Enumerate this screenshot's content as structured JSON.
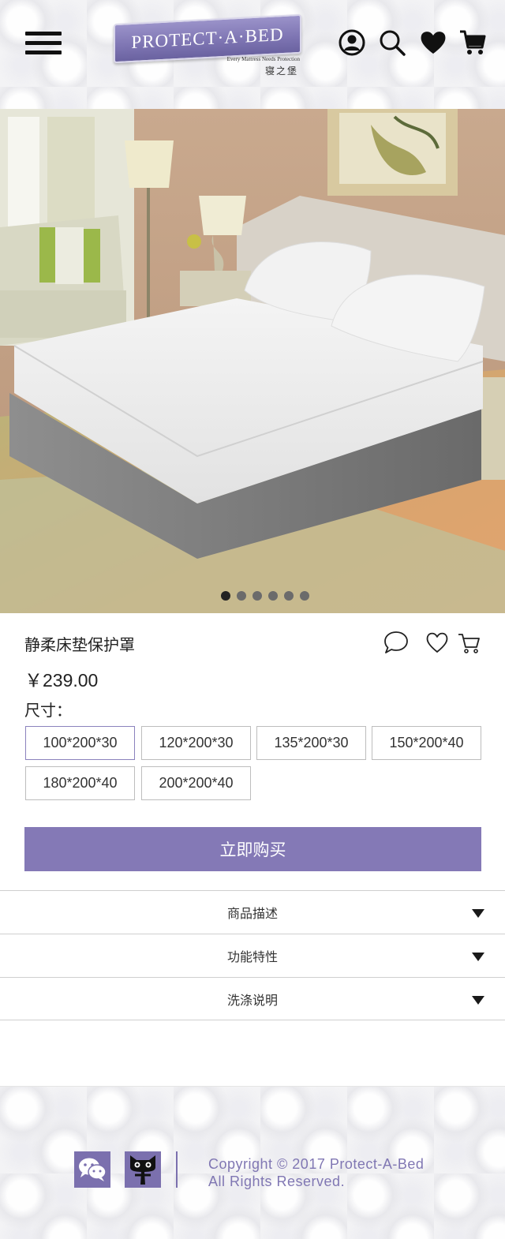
{
  "header": {
    "menu_icon": "hamburger-menu-icon",
    "logo": {
      "brand": "PROTECT·A·BED",
      "tagline": "Every Mattress Needs Protection",
      "chinese_name": "寝之堡"
    },
    "icons": [
      "account-icon",
      "search-icon",
      "heart-icon",
      "cart-icon"
    ]
  },
  "hero": {
    "image_alt": "bedroom-with-white-mattress-protector",
    "slide_count": 6,
    "active_slide": 1
  },
  "product": {
    "title": "静柔床垫保护罩",
    "price": "￥239.00",
    "action_icons": [
      "chat-bubble-icon",
      "favorite-outline-icon",
      "cart-outline-icon"
    ],
    "size_label": "尺寸：",
    "sizes": [
      "100*200*30",
      "120*200*30",
      "135*200*30",
      "150*200*40",
      "180*200*40",
      "200*200*40"
    ],
    "selected_size": "100*200*30",
    "buy_label": "立即购买"
  },
  "accordion": {
    "items": [
      {
        "label": "商品描述"
      },
      {
        "label": "功能特性"
      },
      {
        "label": "洗涤说明"
      }
    ]
  },
  "footer": {
    "social_icons": [
      "wechat-icon",
      "tmall-icon"
    ],
    "copyright_line1": "Copyright  © 2017 Protect-A-Bed",
    "copyright_line2": "All Rights Reserved."
  },
  "colors": {
    "brand_purple": "#8479b6",
    "text_dark": "#222222",
    "border_gray": "#cfcfcf"
  }
}
